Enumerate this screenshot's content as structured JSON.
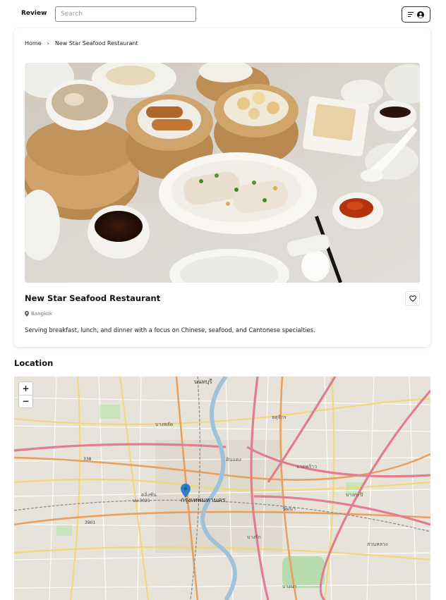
{
  "header": {
    "brand": "Review",
    "search_placeholder": "Search"
  },
  "breadcrumb": {
    "home": "Home",
    "current": "New Star Seafood Restaurant"
  },
  "restaurant": {
    "name": "New Star Seafood Restaurant",
    "city": "Bangkok",
    "description": "Serving breakfast, lunch, and dinner with a focus on Chinese, seafood, and Cantonese specialties."
  },
  "location_section": {
    "title": "Location"
  },
  "map": {
    "zoom_in_label": "+",
    "zoom_out_label": "−",
    "labels": [
      "นนทบุรี",
      "ตลิ่งชัน",
      "กรุงเทพมหานคร",
      "บางรัก",
      "ลาดพร้าว",
      "บางกะปิ",
      "สวนหลวง",
      "บางนา",
      "ดินแดง",
      "วัฒนา",
      "บางพลัด",
      "จตุจักร"
    ],
    "road_numbers": [
      "338",
      "3901",
      "บบ.3021"
    ]
  },
  "icons": {
    "menu": "menu-lines-icon",
    "user": "user-circle-icon",
    "breadcrumb_separator": "chevron-right-icon",
    "favorite": "heart-outline-icon",
    "location": "map-pin-icon",
    "map_marker": "map-marker-icon"
  },
  "colors": {
    "marker": "#2a7fc7",
    "text": "#111111",
    "muted": "#777777"
  }
}
